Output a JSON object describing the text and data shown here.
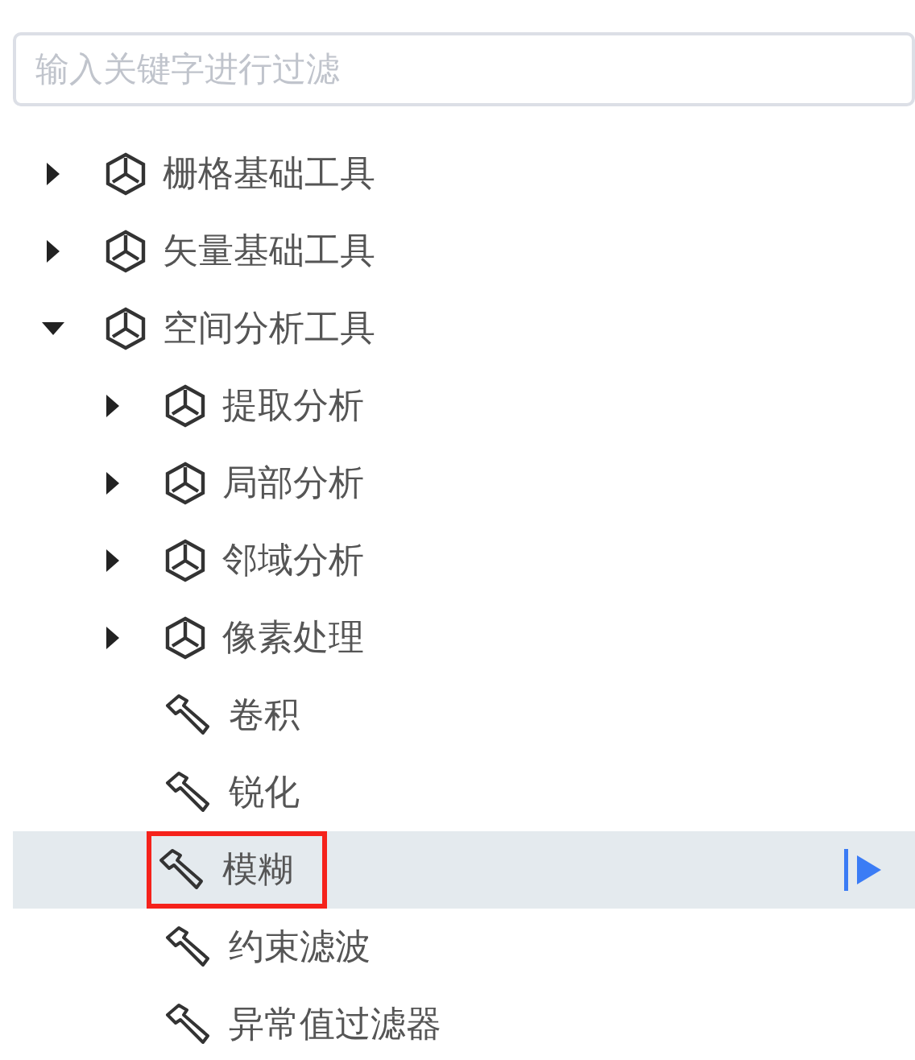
{
  "search": {
    "placeholder": "输入关键字进行过滤"
  },
  "tree": [
    {
      "label": "栅格基础工具",
      "kind": "group",
      "expanded": false,
      "selected": false,
      "outlined": false
    },
    {
      "label": "矢量基础工具",
      "kind": "group",
      "expanded": false,
      "selected": false,
      "outlined": false
    },
    {
      "label": "空间分析工具",
      "kind": "group",
      "expanded": true,
      "selected": false,
      "outlined": false,
      "children": [
        {
          "label": "提取分析",
          "kind": "group",
          "expanded": false,
          "selected": false,
          "outlined": false
        },
        {
          "label": "局部分析",
          "kind": "group",
          "expanded": false,
          "selected": false,
          "outlined": false
        },
        {
          "label": "邻域分析",
          "kind": "group",
          "expanded": false,
          "selected": false,
          "outlined": false
        },
        {
          "label": "像素处理",
          "kind": "group",
          "expanded": false,
          "selected": false,
          "outlined": false
        },
        {
          "label": "卷积",
          "kind": "tool",
          "selected": false,
          "outlined": false
        },
        {
          "label": "锐化",
          "kind": "tool",
          "selected": false,
          "outlined": false
        },
        {
          "label": "模糊",
          "kind": "tool",
          "selected": true,
          "outlined": true
        },
        {
          "label": "约束滤波",
          "kind": "tool",
          "selected": false,
          "outlined": false
        },
        {
          "label": "异常值过滤器",
          "kind": "tool",
          "selected": false,
          "outlined": false
        }
      ]
    }
  ]
}
